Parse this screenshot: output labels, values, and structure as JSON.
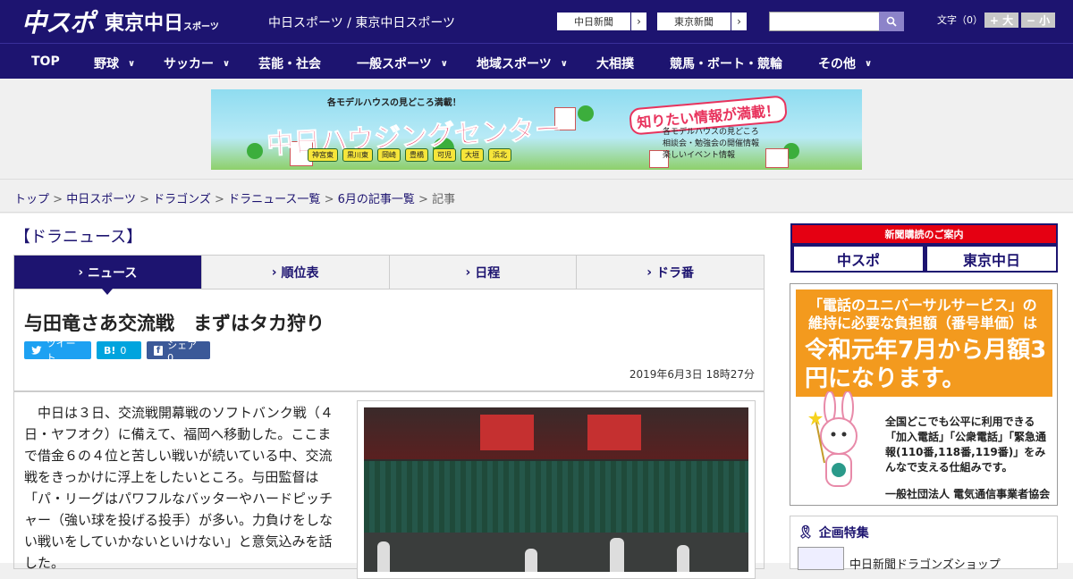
{
  "header": {
    "logo_primary": "中スポ",
    "logo_secondary": "東京中日",
    "logo_secondary_small": "スポーツ",
    "site_name": "中日スポーツ / 東京中日スポーツ",
    "paper_links": [
      "中日新聞",
      "東京新聞"
    ],
    "search": {
      "placeholder": "",
      "icon": "search-icon"
    },
    "font_size_label": "文字（0）",
    "font_bigger": "+ 大",
    "font_smaller": "− 小"
  },
  "nav": {
    "items": [
      {
        "label": "TOP",
        "dropdown": false
      },
      {
        "label": "野球",
        "dropdown": true
      },
      {
        "label": "サッカー",
        "dropdown": true
      },
      {
        "label": "芸能・社会",
        "dropdown": false
      },
      {
        "label": "一般スポーツ",
        "dropdown": true
      },
      {
        "label": "地域スポーツ",
        "dropdown": true
      },
      {
        "label": "大相撲",
        "dropdown": false
      },
      {
        "label": "競馬・ボート・競輪",
        "dropdown": false
      },
      {
        "label": "その他",
        "dropdown": true
      }
    ]
  },
  "ad_banner": {
    "sub": "各モデルハウスの見どころ満載！",
    "title": "中日ハウジングセンター",
    "tagline": "知りたい情報が満載！",
    "lines": [
      "各モデルハウスの見どころ",
      "相談会・勉強会の開催情報",
      "楽しいイベント情報"
    ],
    "cities": [
      "神宮東",
      "黒川東",
      "岡崎",
      "豊橋",
      "可児",
      "大垣",
      "浜北"
    ]
  },
  "breadcrumb": {
    "links": [
      "トップ",
      "中日スポーツ",
      "ドラゴンズ",
      "ドラニュース一覧",
      "6月の記事一覧"
    ],
    "current": "記事",
    "separator": ">"
  },
  "section_title": "【ドラニュース】",
  "tabs": [
    {
      "label": "ニュース",
      "active": true
    },
    {
      "label": "順位表",
      "active": false
    },
    {
      "label": "日程",
      "active": false
    },
    {
      "label": "ドラ番",
      "active": false
    }
  ],
  "article": {
    "headline": "与田竜さあ交流戦　まずはタカ狩り",
    "share": {
      "tweet": "ツイート",
      "hatena_count": "0",
      "facebook": "シェア 0"
    },
    "date": "2019年6月3日 18時27分",
    "body": "　中日は３日、交流戦開幕戦のソフトバンク戦（４日・ヤフオク）に備えて、福岡へ移動した。ここまで借金６の４位と苦しい戦いが続いている中、交流戦をきっかけに浮上をしたいところ。与田監督は「パ・リーグはパワフルなバッターやハードピッチャー（強い球を投げる投手）が多い。力負けをしない戦いをしていかないといけない」と意気込みを話した。"
  },
  "sidebar": {
    "subscribe_header": "新聞購読のご案内",
    "subscribe_buttons": [
      "中スポ",
      "東京中日"
    ],
    "ad": {
      "question": "「電話のユニバーサルサービス」の維持に必要な負担額（番号単価）は",
      "big": "令和元年7月から月額3円になります。",
      "text": "全国どこでも公平に利用できる「加入電話」「公衆電話」「緊急通報(110番,118番,119番)」をみんなで支える仕組みです。",
      "org": "一般社団法人 電気通信事業者協会"
    },
    "feature_title": "企画特集",
    "feature_item": "中日新聞ドラゴンズショップ"
  },
  "colors": {
    "brand": "#1d1470",
    "twitter": "#1da1f2",
    "hatena": "#00a4de",
    "facebook": "#3b5998",
    "accent_red": "#e50012",
    "ad_orange": "#f39a1e"
  }
}
